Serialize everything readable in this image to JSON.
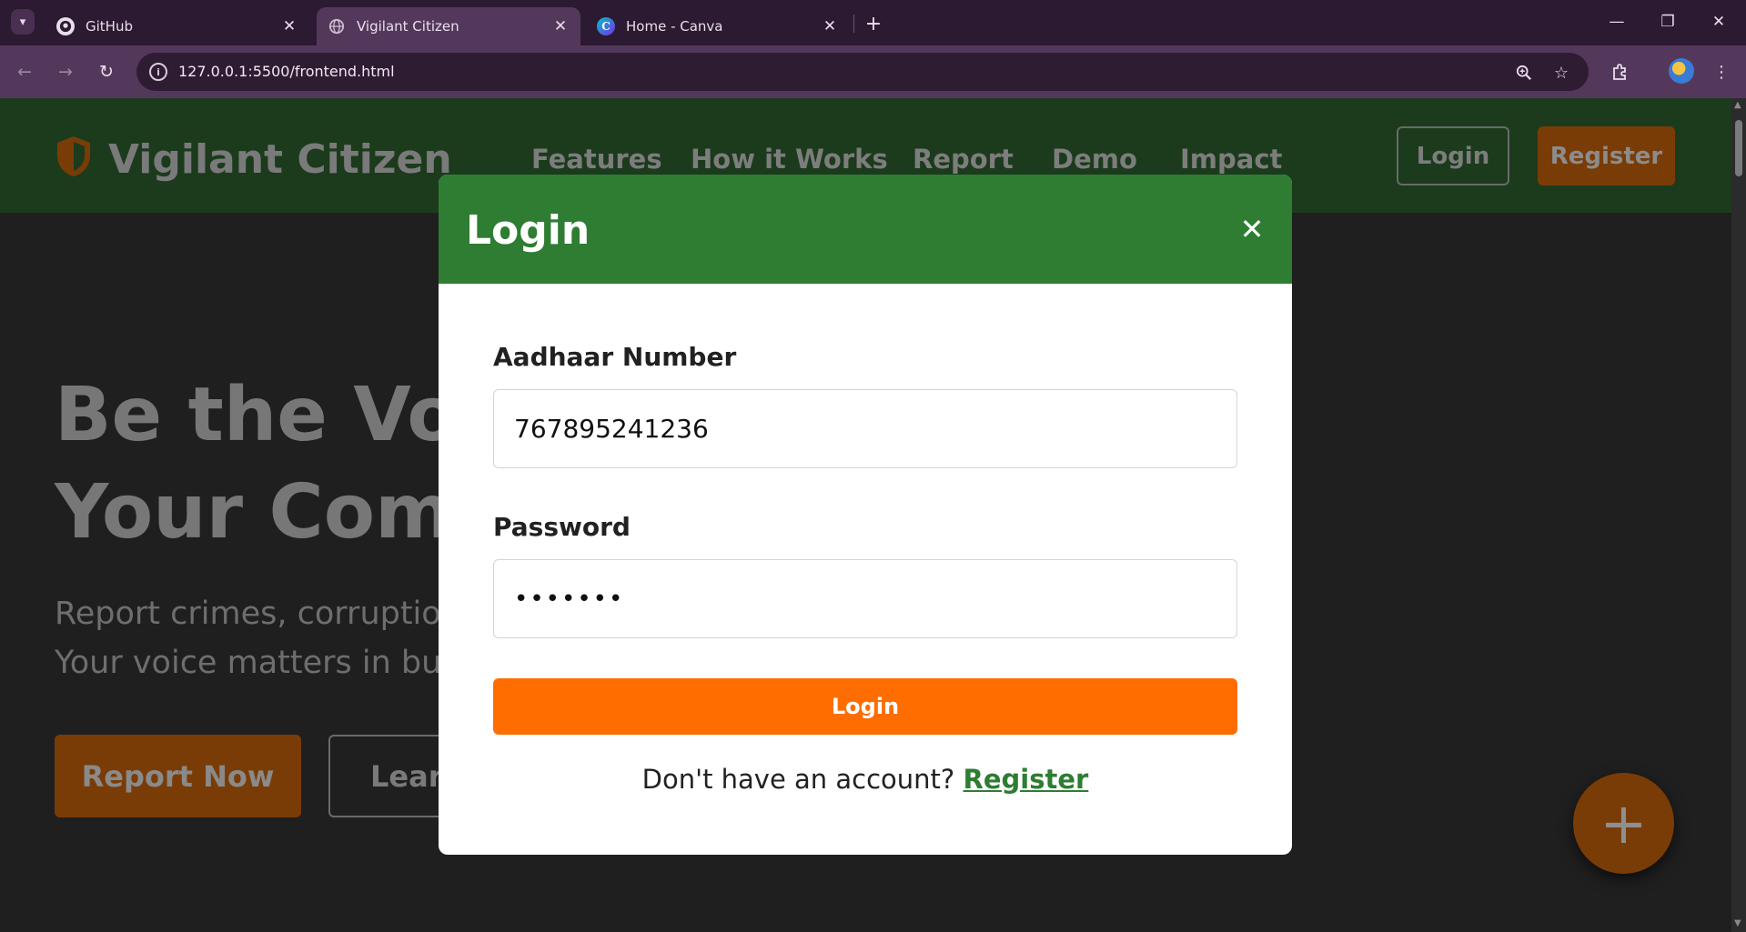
{
  "browser": {
    "tabs": [
      {
        "title": "GitHub",
        "icon": "github-icon",
        "active": false
      },
      {
        "title": "Vigilant Citizen",
        "icon": "globe-icon",
        "active": true
      },
      {
        "title": "Home - Canva",
        "icon": "canva-icon",
        "active": false
      }
    ],
    "url": "127.0.0.1:5500/frontend.html",
    "window_controls": {
      "minimize": "—",
      "restore": "❐",
      "close": "✕"
    }
  },
  "site": {
    "logo_text": "Vigilant Citizen",
    "nav_links": [
      "Features",
      "How it Works",
      "Report",
      "Demo",
      "Impact"
    ],
    "login_label": "Login",
    "register_label": "Register",
    "hero_title_line1": "Be the Voi",
    "hero_title_line2": "Your Comm",
    "hero_sub_line1": "Report crimes, corruption,",
    "hero_sub_line2": "Your voice matters in build",
    "report_now_label": "Report Now",
    "learn_label": "Learn",
    "fab_symbol": "+"
  },
  "modal": {
    "title": "Login",
    "close_symbol": "✕",
    "aadhaar_label": "Aadhaar Number",
    "aadhaar_value": "767895241236",
    "password_label": "Password",
    "password_value": "•••••••",
    "submit_label": "Login",
    "switch_text": "Don't have an account?",
    "switch_link": "Register"
  },
  "colors": {
    "modal_header": "#2e7d32",
    "primary_orange": "#ff6d00",
    "browser_chrome": "#54385b"
  }
}
